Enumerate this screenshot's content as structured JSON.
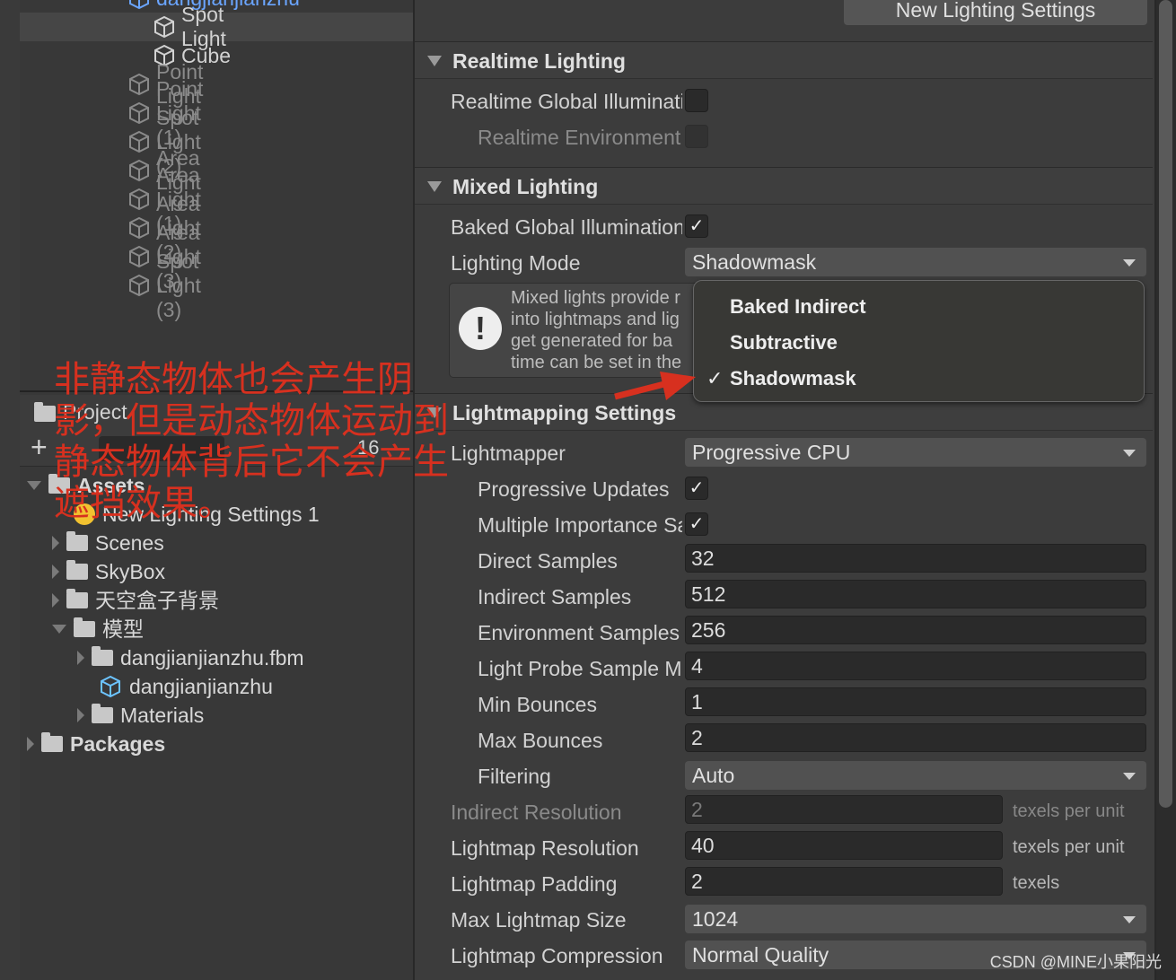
{
  "hierarchy": {
    "items": [
      {
        "label": "dangjianjianzhu",
        "dim": false,
        "indent": 1
      },
      {
        "label": "Spot Light",
        "dim": false,
        "indent": 2,
        "selected": true
      },
      {
        "label": "Cube",
        "dim": false,
        "indent": 2
      },
      {
        "label": "Point Light",
        "dim": true,
        "indent": 1
      },
      {
        "label": "Point Light (1)",
        "dim": true,
        "indent": 1
      },
      {
        "label": "Spot Light (2)",
        "dim": true,
        "indent": 1
      },
      {
        "label": "Area Light",
        "dim": true,
        "indent": 1
      },
      {
        "label": "Area Light (1)",
        "dim": true,
        "indent": 1
      },
      {
        "label": "Area Light (2)",
        "dim": true,
        "indent": 1
      },
      {
        "label": "Area Light (3)",
        "dim": true,
        "indent": 1
      },
      {
        "label": "Spot Light (3)",
        "dim": true,
        "indent": 1
      }
    ]
  },
  "project": {
    "tab": "Project",
    "hidden_count": "16",
    "tree": [
      {
        "label": "Assets",
        "bold": true,
        "open": true,
        "level": 0
      },
      {
        "label": "New Lighting Settings 1",
        "level": 1,
        "icon": "lighting-settings"
      },
      {
        "label": "Scenes",
        "level": 1
      },
      {
        "label": "SkyBox",
        "level": 1
      },
      {
        "label": "天空盒子背景",
        "level": 1
      },
      {
        "label": "模型",
        "level": 1,
        "open": true
      },
      {
        "label": "dangjianjianzhu.fbm",
        "level": 2
      },
      {
        "label": "dangjianjianzhu",
        "level": 2,
        "icon": "prefab"
      },
      {
        "label": "Materials",
        "level": 2
      },
      {
        "label": "Packages",
        "bold": true,
        "level": 0
      }
    ]
  },
  "inspector": {
    "new_button": "New Lighting Settings",
    "realtime": {
      "title": "Realtime Lighting",
      "gi_label": "Realtime Global Illumination",
      "gi": false,
      "env_label": "Realtime Environment Lighting",
      "env": false
    },
    "mixed": {
      "title": "Mixed Lighting",
      "baked_label": "Baked Global Illumination",
      "baked": true,
      "mode_label": "Lighting Mode",
      "mode": "Shadowmask",
      "help": [
        "Mixed lights provide r",
        "into lightmaps and lig",
        "get generated for ba",
        "time can be set in the"
      ]
    },
    "popup": {
      "options": [
        "Baked Indirect",
        "Subtractive",
        "Shadowmask"
      ],
      "selected": "Shadowmask"
    },
    "lightmapping": {
      "title": "Lightmapping Settings",
      "lightmapper_label": "Lightmapper",
      "lightmapper": "Progressive CPU",
      "prog_label": "Progressive Updates",
      "prog": true,
      "mis_label": "Multiple Importance Sampling",
      "mis": true,
      "rows": [
        {
          "label": "Direct Samples",
          "value": "32"
        },
        {
          "label": "Indirect Samples",
          "value": "512"
        },
        {
          "label": "Environment Samples",
          "value": "256"
        },
        {
          "label": "Light Probe Sample Multiplier",
          "value": "4"
        },
        {
          "label": "Min Bounces",
          "value": "1"
        },
        {
          "label": "Max Bounces",
          "value": "2"
        }
      ],
      "filtering_label": "Filtering",
      "filtering": "Auto",
      "indirect_res_label": "Indirect Resolution",
      "indirect_res": "2",
      "indirect_res_unit": "texels per unit",
      "lm_res_label": "Lightmap Resolution",
      "lm_res": "40",
      "lm_res_unit": "texels per unit",
      "padding_label": "Lightmap Padding",
      "padding": "2",
      "padding_unit": "texels",
      "max_size_label": "Max Lightmap Size",
      "max_size": "1024",
      "compression_label": "Lightmap Compression",
      "compression": "Normal Quality"
    }
  },
  "annotation": "非静态物体也会产生阴影，但是动态物体运动到静态物体背后它不会产生遮挡效果。",
  "watermark": "CSDN @MINE小果阳光",
  "colors": {
    "annotation": "#d7301f",
    "panel": "#3c3c3c"
  }
}
